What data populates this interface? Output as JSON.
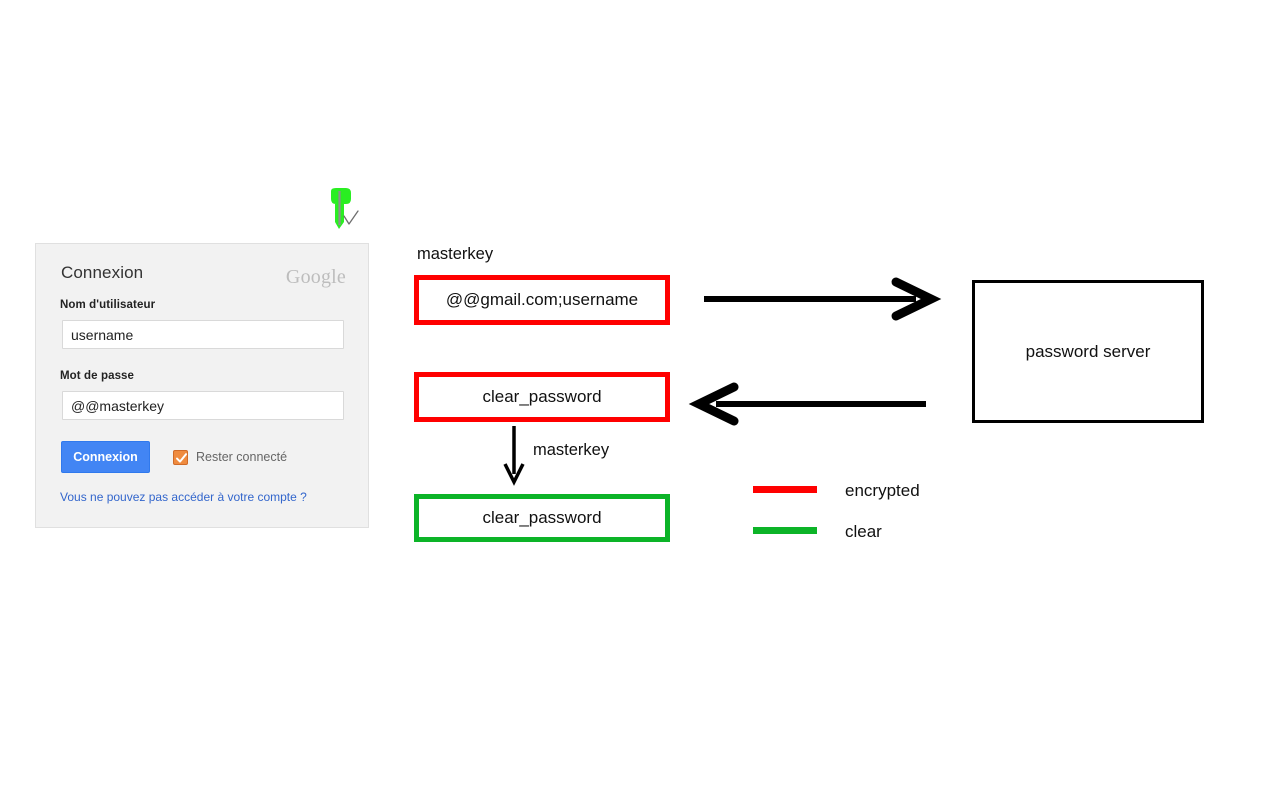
{
  "login_card": {
    "title": "Connexion",
    "brand": "Google",
    "username_label": "Nom d'utilisateur",
    "username_value": "username",
    "username_placeholder": "",
    "password_label": "Mot de passe",
    "password_value": "@@masterkey",
    "password_placeholder": "",
    "submit_label": "Connexion",
    "stay_signed_in_label": "Rester connecté",
    "stay_signed_in_checked": true,
    "help_link": "Vous ne pouvez pas accéder à votre compte ?",
    "accent_color": "#4285f4",
    "checkbox_color": "#ef8b3f",
    "link_color": "#3366cc"
  },
  "extension_icon": {
    "name": "green-screw-pin-icon",
    "color": "#2aee22"
  },
  "diagram": {
    "label_masterkey_top": "masterkey",
    "label_masterkey_middle": "masterkey",
    "box_encrypted_credentials": "@@gmail.com;username",
    "box_encrypted_password": "clear_password",
    "box_clear_password": "clear_password",
    "box_server": "password server",
    "encrypted_color": "#ff0000",
    "clear_color": "#0cb428",
    "server_border_color": "#000000",
    "arrow_color": "#000000"
  },
  "legend": {
    "items": [
      {
        "label": "encrypted",
        "color": "#ff0000"
      },
      {
        "label": "clear",
        "color": "#0cb428"
      }
    ]
  }
}
